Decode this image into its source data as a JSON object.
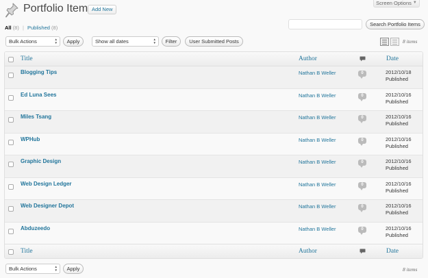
{
  "header": {
    "screen_options": "Screen Options",
    "title": "Portfolio Items",
    "add_new": "Add New",
    "title_icon": "pushpin-icon"
  },
  "filters": {
    "all_label": "All",
    "all_count": "(8)",
    "separator": "|",
    "published_label": "Published",
    "published_count": "(8)"
  },
  "search": {
    "value": "",
    "button": "Search Portfolio Items"
  },
  "tablenav_top": {
    "bulk_actions": "Bulk Actions",
    "apply": "Apply",
    "dates": "Show all dates",
    "filter": "Filter",
    "user_submitted": "User Submitted Posts",
    "count": "8 items"
  },
  "tablenav_bottom": {
    "bulk_actions": "Bulk Actions",
    "apply": "Apply",
    "count": "8 items"
  },
  "columns": {
    "title": "Title",
    "author": "Author",
    "comments_icon": "comment-icon",
    "date": "Date"
  },
  "rows": [
    {
      "title": "Blogging Tips",
      "author": "Nathan B Weller",
      "comments": "0",
      "date": "2012/10/18",
      "status": "Published"
    },
    {
      "title": "Ed Luna Sees",
      "author": "Nathan B Weller",
      "comments": "0",
      "date": "2012/10/16",
      "status": "Published"
    },
    {
      "title": "Miles Tsang",
      "author": "Nathan B Weller",
      "comments": "0",
      "date": "2012/10/16",
      "status": "Published"
    },
    {
      "title": "WPHub",
      "author": "Nathan B Weller",
      "comments": "0",
      "date": "2012/10/16",
      "status": "Published"
    },
    {
      "title": "Graphic Design",
      "author": "Nathan B Weller",
      "comments": "0",
      "date": "2012/10/16",
      "status": "Published"
    },
    {
      "title": "Web Design Ledger",
      "author": "Nathan B Weller",
      "comments": "0",
      "date": "2012/10/16",
      "status": "Published"
    },
    {
      "title": "Web Designer Depot",
      "author": "Nathan B Weller",
      "comments": "0",
      "date": "2012/10/16",
      "status": "Published"
    },
    {
      "title": "Abduzeedo",
      "author": "Nathan B Weller",
      "comments": "0",
      "date": "2012/10/16",
      "status": "Published"
    }
  ],
  "colors": {
    "link": "#21759b",
    "background": "#f9f9f9",
    "row_alt": "#f1f1f1"
  }
}
